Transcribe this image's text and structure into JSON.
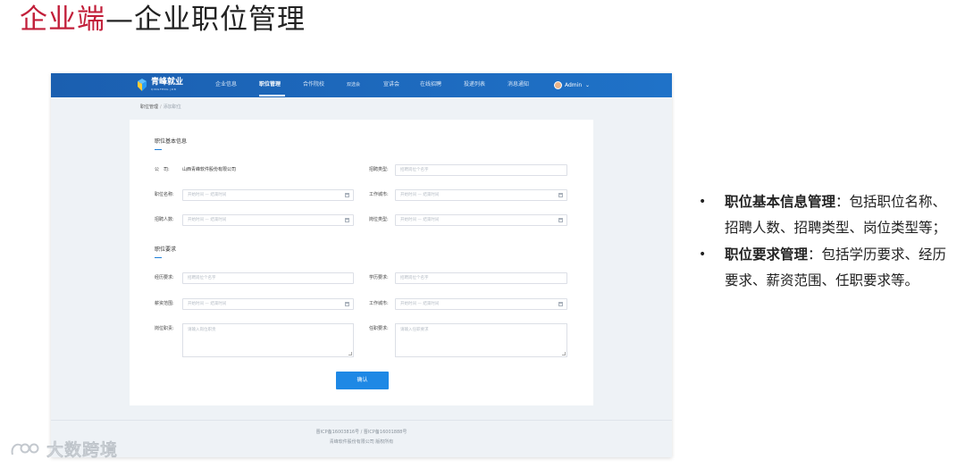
{
  "slide": {
    "title_accent": "企业端",
    "title_rest": "—企业职位管理"
  },
  "app": {
    "brand": "青峰就业",
    "brand_sub": "QINGFENG JOB",
    "nav": [
      "企业信息",
      "职位管理",
      "合作院校",
      "双选会",
      "宣讲会",
      "在线招聘",
      "投递列表",
      "消息通知"
    ],
    "nav_active": "职位管理",
    "user": "Admin",
    "breadcrumb": [
      "职位管理",
      "添加职位"
    ],
    "sections": {
      "basic": "职位基本信息",
      "requirements": "职位要求"
    },
    "fields": {
      "company_label": "公　司:",
      "company_value": "山西青峰软件股份有限公司",
      "job_type_label": "招聘类型:",
      "job_type_ph": "招聘岗位个名字",
      "position_name_label": "职位名称:",
      "position_name_ph": "开始时间 — 结束时间",
      "work_city_label": "工作城市:",
      "work_city_ph": "开始时间 — 结束时间",
      "headcount_label": "招聘人数:",
      "headcount_ph": "开始时间 — 结束时间",
      "post_type_label": "岗位类型:",
      "post_type_ph": "开始时间 — 结束时间",
      "experience_label": "经历要求:",
      "experience_ph": "招聘岗位个名字",
      "education_label": "学历要求:",
      "education_ph": "招聘岗位个名字",
      "salary_label": "薪资范围:",
      "salary_ph": "开始时间 — 结束时间",
      "work_city2_label": "工作城市:",
      "work_city2_ph": "开始时间 — 结束时间",
      "duty_label": "岗位职责:",
      "duty_ph": "请输入岗位职责",
      "req_label": "任职要求:",
      "req_ph": "请输入任职要求"
    },
    "confirm": "确认",
    "footer1": "晋ICP备16003816号 / 晋ICP备16001888号",
    "footer2": "青峰软件股份有限公司 版权所有"
  },
  "bullets": [
    {
      "bold": "职位基本信息管理",
      "text": "：包括职位名称、招聘人数、招聘类型、岗位类型等；"
    },
    {
      "bold": "职位要求管理",
      "text": "：包括学历要求、经历要求、薪资范围、任职要求等。"
    }
  ],
  "watermark": "大数跨境",
  "colors": {
    "accent": "#c21f3a",
    "nav_blue": "#1b5fb0",
    "button_blue": "#1e88e5"
  }
}
